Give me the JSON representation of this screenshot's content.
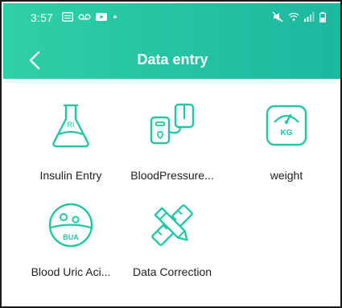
{
  "status_bar": {
    "time": "3:57",
    "icons_left": [
      "gallery-icon",
      "voicemail-icon",
      "video-icon",
      "dot-icon"
    ],
    "icons_right": [
      "mute-icon",
      "wifi-icon",
      "signal-icon",
      "battery-icon"
    ]
  },
  "header": {
    "title": "Data entry",
    "back_icon": "chevron-left-icon",
    "color_start": "#2fd0a6",
    "color_end": "#1cb79f"
  },
  "accent_color": "#22c7a3",
  "entries": [
    {
      "label": "Insulin Entry",
      "icon": "flask-icon",
      "icon_text": "RI"
    },
    {
      "label": "BloodPressure...",
      "icon": "blood-pressure-icon",
      "icon_text": ""
    },
    {
      "label": "weight",
      "icon": "scale-icon",
      "icon_text": "KG"
    },
    {
      "label": "Blood Uric Aci...",
      "icon": "petri-dish-icon",
      "icon_text": "BUA"
    },
    {
      "label": "Data Correction",
      "icon": "pencil-ruler-icon",
      "icon_text": ""
    }
  ]
}
